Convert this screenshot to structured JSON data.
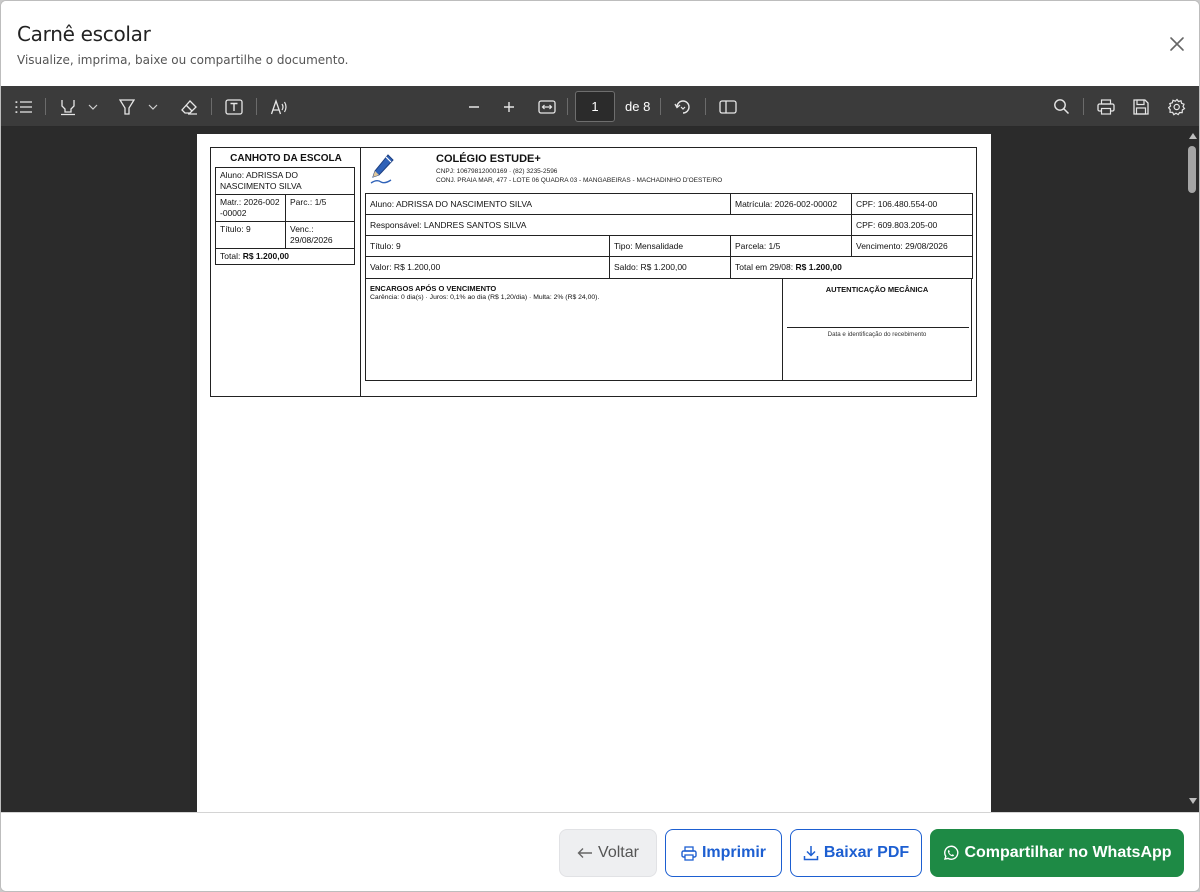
{
  "dialog": {
    "title": "Carnê escolar",
    "subtitle": "Visualize, imprima, baixe ou compartilhe o documento."
  },
  "viewer": {
    "current_page": "1",
    "page_of": "de 8",
    "toolbar_icons": [
      "list-icon",
      "highlight-icon",
      "chevron-down-icon",
      "draw-icon",
      "chevron-down-icon",
      "eraser-icon",
      "text-box-icon",
      "read-aloud-icon",
      "zoom-out-icon",
      "zoom-in-icon",
      "fit-width-icon",
      "rotate-icon",
      "page-view-icon",
      "search-icon",
      "print-icon",
      "save-icon",
      "settings-icon"
    ]
  },
  "carne": {
    "stub": {
      "title": "CANHOTO DA ESCOLA",
      "aluno_label": "Aluno:",
      "aluno": "ADRISSA DO NASCIMENTO SILVA",
      "matr_label": "Matr.:",
      "matr": "2026-002-00002",
      "parc_label": "Parc.:",
      "parc": "1/5",
      "titulo_label": "Título:",
      "titulo": "9",
      "venc_label": "Venc.:",
      "venc": "29/08/2026",
      "total_label": "Total:",
      "total": "R$ 1.200,00"
    },
    "school": {
      "name": "COLÉGIO ESTUDE+",
      "line1": "CNPJ: 10679812000169 · (82) 3235-2596",
      "line2": "CONJ. PRAIA MAR, 477 - LOTE 06 QUADRA 03 - MANGABEIRAS - MACHADINHO D'OESTE/RO"
    },
    "rows": {
      "aluno": "Aluno: ADRISSA DO NASCIMENTO SILVA",
      "matricula": "Matrícula: 2026-002-00002",
      "cpf1": "CPF: 106.480.554-00",
      "responsavel": "Responsável: LANDRES SANTOS SILVA",
      "cpf2": "CPF: 609.803.205-00",
      "titulo": "Título: 9",
      "tipo": "Tipo: Mensalidade",
      "parcela": "Parcela: 1/5",
      "vencimento": "Vencimento: 29/08/2026",
      "valor": "Valor: R$ 1.200,00",
      "saldo": "Saldo: R$ 1.200,00",
      "total_label": "Total em 29/08:",
      "total": "R$ 1.200,00"
    },
    "encargos": {
      "title": "ENCARGOS APÓS O VENCIMENTO",
      "text": "Carência: 0 dia(s) · Juros: 0,1% ao dia (R$ 1,20/dia) · Multa: 2% (R$ 24,00)."
    },
    "auth": {
      "title": "AUTENTICAÇÃO MECÂNICA",
      "caption": "Data e identificação do recebimento"
    }
  },
  "footer": {
    "voltar": "Voltar",
    "imprimir": "Imprimir",
    "baixar": "Baixar PDF",
    "whatsapp": "Compartilhar no WhatsApp"
  },
  "colors": {
    "primary_blue": "#1d5fd1",
    "whatsapp_green": "#1e8a45",
    "toolbar_bg": "#3b3b3b",
    "viewer_bg": "#2b2b2b"
  }
}
